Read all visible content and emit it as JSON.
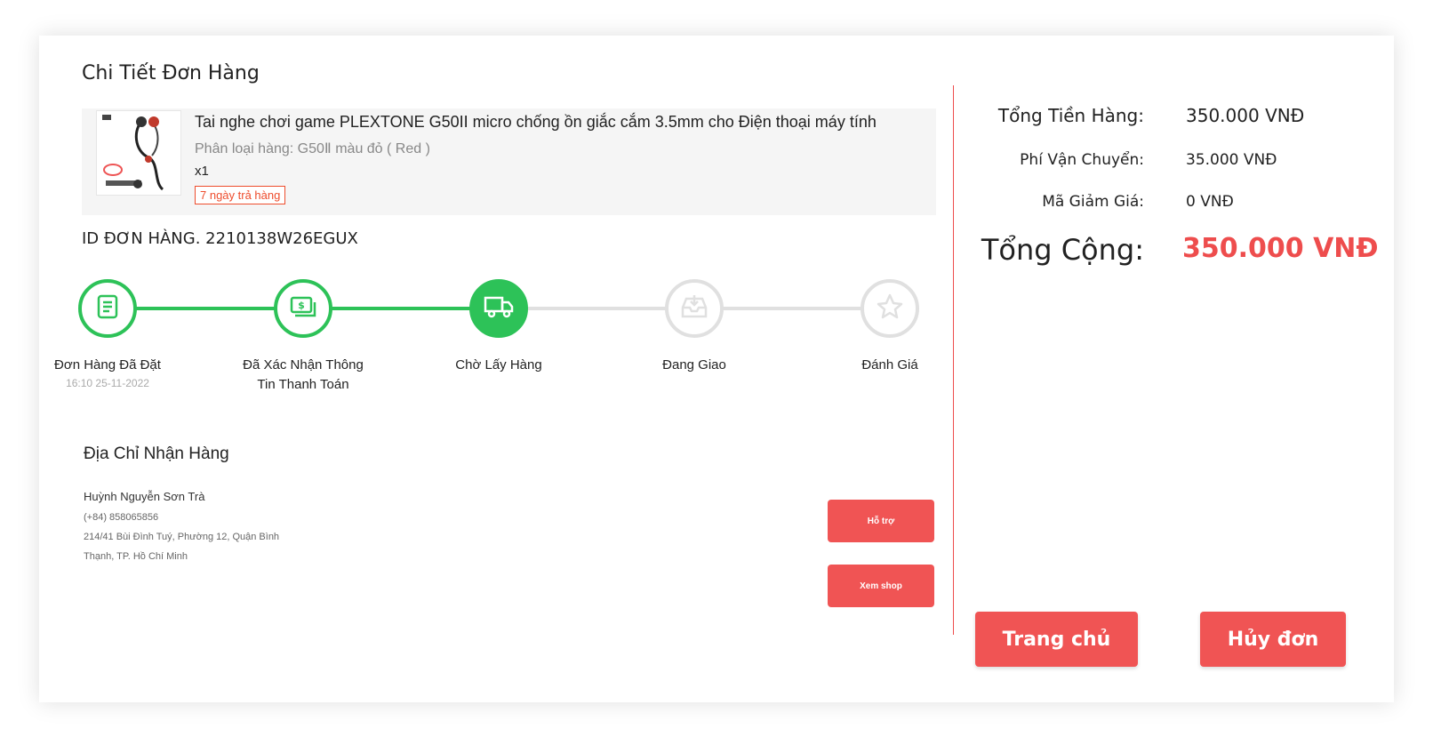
{
  "page_title": "Chi Tiết Đơn Hàng",
  "product": {
    "name": "Tai nghe chơi game PLEXTONE G50II micro chống ồn giắc cắm 3.5mm cho Điện thoại máy tính",
    "variant": "Phân loại hàng: G50Ⅱ màu đỏ ( Red )",
    "quantity": "x1",
    "return_badge": "7 ngày trả hàng"
  },
  "order_id": "ID ĐƠN HÀNG. 2210138W26EGUX",
  "steps": [
    {
      "label": "Đơn Hàng Đã Đặt",
      "sub": "16:10 25-11-2022",
      "state": "done",
      "icon": "receipt-icon"
    },
    {
      "label": "Đã Xác Nhận Thông",
      "label2": "Tin Thanh Toán",
      "state": "done",
      "icon": "money-icon"
    },
    {
      "label": "Chờ Lấy Hàng",
      "state": "active",
      "icon": "truck-icon"
    },
    {
      "label": "Đang Giao",
      "state": "todo",
      "icon": "inbox-icon"
    },
    {
      "label": "Đánh Giá",
      "state": "todo",
      "icon": "star-icon"
    }
  ],
  "address": {
    "title": "Địa Chỉ Nhận Hàng",
    "name": "Huỳnh Nguyễn Sơn Trà",
    "phone": "(+84) 858065856",
    "line1": "214/41 Bùi Đình Tuý, Phường 12, Quận Bình",
    "line2": "Thạnh, TP. Hồ Chí Minh"
  },
  "buttons": {
    "support": "Hỗ trợ",
    "view_shop": "Xem shop",
    "home": "Trang chủ",
    "cancel": "Hủy đơn"
  },
  "totals": {
    "subtotal_label": "Tổng Tiền Hàng:",
    "subtotal_value": "350.000 VNĐ",
    "shipping_label": "Phí Vận Chuyển:",
    "shipping_value": "35.000 VNĐ",
    "discount_label": "Mã Giảm Giá:",
    "discount_value": "0 VNĐ",
    "grand_label": "Tổng Cộng:",
    "grand_value": "350.000 VNĐ"
  },
  "colors": {
    "accent_red": "#ee4d4d",
    "button_red": "#f05454",
    "step_green": "#2dc258",
    "step_gray": "#e0e0e0"
  }
}
